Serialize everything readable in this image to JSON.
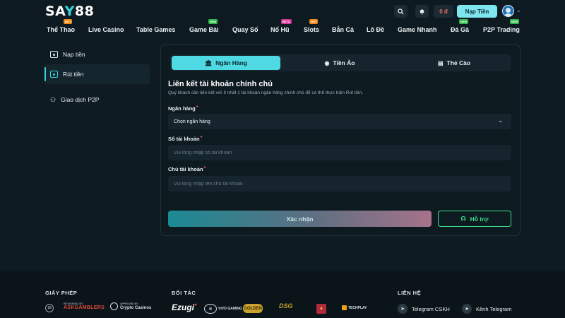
{
  "header": {
    "logo": {
      "part1": "SA",
      "part2": "Y",
      "part3": "88"
    },
    "balance": "0 đ",
    "deposit_label": "Nạp Tiền",
    "nav": [
      {
        "label": "Thể Thao",
        "badge": "HOT",
        "badge_type": "hot"
      },
      {
        "label": "Live Casino",
        "badge": "",
        "badge_type": ""
      },
      {
        "label": "Table Games",
        "badge": "",
        "badge_type": ""
      },
      {
        "label": "Game Bài",
        "badge": "NEW",
        "badge_type": "new"
      },
      {
        "label": "Quay Số",
        "badge": "",
        "badge_type": ""
      },
      {
        "label": "Nổ Hũ",
        "badge": "BETA",
        "badge_type": "beta"
      },
      {
        "label": "Slots",
        "badge": "HOT",
        "badge_type": "hot"
      },
      {
        "label": "Bắn Cá",
        "badge": "",
        "badge_type": ""
      },
      {
        "label": "Lô Đề",
        "badge": "",
        "badge_type": ""
      },
      {
        "label": "Game Nhanh",
        "badge": "",
        "badge_type": ""
      },
      {
        "label": "Đá Gà",
        "badge": "NEW",
        "badge_type": "new"
      },
      {
        "label": "P2P Trading",
        "badge": "NEW",
        "badge_type": "new"
      }
    ]
  },
  "sidebar": {
    "items": [
      {
        "label": "Nạp tiền",
        "active": false
      },
      {
        "label": "Rút tiền",
        "active": true
      },
      {
        "label": "Giao dịch P2P",
        "active": false
      }
    ]
  },
  "tabs": [
    {
      "label": "Ngân Hàng",
      "icon": "bank-icon",
      "active": true
    },
    {
      "label": "Tiền Ảo",
      "icon": "coin-icon",
      "active": false
    },
    {
      "label": "Thẻ Cào",
      "icon": "card-icon",
      "active": false
    }
  ],
  "form": {
    "title": "Liên kết tài khoản chính chủ",
    "description": "Quý khách cần liên kết với ít nhất 1 tài khoản ngân hàng chính chủ để có thể thực hiện Rút tiền.",
    "bank_label": "Ngân hàng",
    "bank_value": "Chọn ngân hàng",
    "account_number_label": "Số tài khoản",
    "account_number_placeholder": "Vui lòng nhập số tài khoản",
    "account_holder_label": "Chủ tài khoản",
    "account_holder_placeholder": "Vui lòng nhập tên chủ tài khoản",
    "required_mark": "*",
    "confirm_label": "Xác nhận",
    "support_label": "Hỗ trợ"
  },
  "footer": {
    "license_heading": "GIẤY PHÉP",
    "partners_heading": "ĐỐI TÁC",
    "contact_heading": "LIÊN HỆ",
    "age_badge": "18",
    "askgamblers_small": "REVIEWED BY",
    "askgamblers_big": "ASKGAMBLERS",
    "crypto_small": "APPROVED BY",
    "crypto_big": "Crypto Casinos",
    "partners": {
      "ezugi": "Ezugi",
      "vivo": "VIVO GAMING",
      "golden": "GOLDEN",
      "dsg": "DSG",
      "tech": "TECHPLAY"
    },
    "telegram_cskh": "Telegram CSKH",
    "telegram_channel": "Kênh Telegram"
  },
  "colors": {
    "accent": "#4fd9e2",
    "support": "#3ee08a",
    "hot": "#f08a1a",
    "new": "#2fb84a",
    "beta": "#d23a9c"
  }
}
